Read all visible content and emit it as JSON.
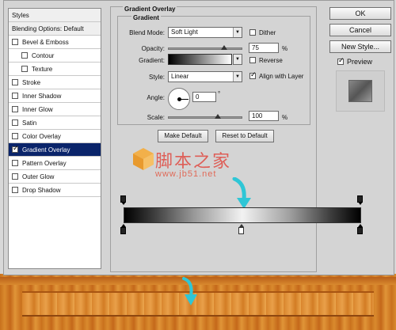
{
  "dialog": {
    "styles_list": [
      {
        "label": "Styles",
        "type": "header"
      },
      {
        "label": "Blending Options: Default",
        "type": "header"
      },
      {
        "label": "Bevel & Emboss",
        "checked": false
      },
      {
        "label": "Contour",
        "checked": false,
        "indent": true
      },
      {
        "label": "Texture",
        "checked": false,
        "indent": true
      },
      {
        "label": "Stroke",
        "checked": false
      },
      {
        "label": "Inner Shadow",
        "checked": false
      },
      {
        "label": "Inner Glow",
        "checked": false
      },
      {
        "label": "Satin",
        "checked": false
      },
      {
        "label": "Color Overlay",
        "checked": false
      },
      {
        "label": "Gradient Overlay",
        "checked": true,
        "active": true
      },
      {
        "label": "Pattern Overlay",
        "checked": false
      },
      {
        "label": "Outer Glow",
        "checked": false
      },
      {
        "label": "Drop Shadow",
        "checked": false
      }
    ],
    "group_title": "Gradient Overlay",
    "inner_title": "Gradient",
    "blend_mode": {
      "label": "Blend Mode:",
      "value": "Soft Light"
    },
    "dither": {
      "label": "Dither",
      "checked": false
    },
    "opacity": {
      "label": "Opacity:",
      "value": "75",
      "unit": "%",
      "level": 0.75
    },
    "gradient": {
      "label": "Gradient:"
    },
    "reverse": {
      "label": "Reverse",
      "checked": false
    },
    "style": {
      "label": "Style:",
      "value": "Linear"
    },
    "align_with_layer": {
      "label": "Align with Layer",
      "checked": true
    },
    "angle": {
      "label": "Angle:",
      "value": "0",
      "unit": "°"
    },
    "scale": {
      "label": "Scale:",
      "value": "100",
      "unit": "%",
      "level": 0.67
    },
    "make_default": "Make Default",
    "reset_to_default": "Reset to Default",
    "ok": "OK",
    "cancel": "Cancel",
    "new_style": "New Style...",
    "preview": {
      "label": "Preview",
      "checked": true
    }
  },
  "watermark": {
    "main": "脚本之家",
    "sub": "www.jb51.net"
  },
  "colors": {
    "selection": "#0a246a",
    "arrow": "#2fc6d6",
    "watermark": "#e0524a",
    "wood": "#d98a2e"
  }
}
